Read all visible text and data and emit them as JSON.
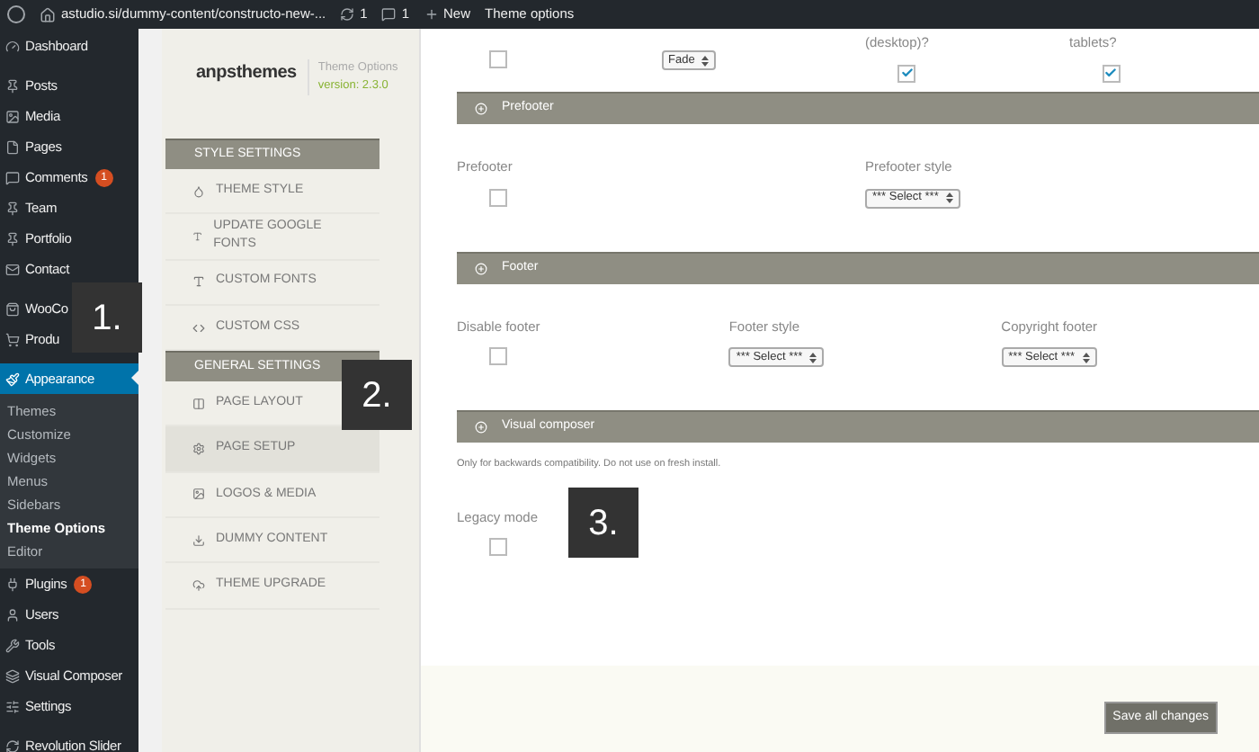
{
  "admin_bar": {
    "site_url": "astudio.si/dummy-content/constructo-new-...",
    "updates_count": "1",
    "comments_count": "1",
    "new_label": "New",
    "page_label": "Theme options"
  },
  "sidebar": {
    "groups": [
      [
        {
          "label": "Dashboard",
          "selected": false
        }
      ],
      [
        {
          "label": "Posts",
          "selected": false
        },
        {
          "label": "Media",
          "selected": false
        },
        {
          "label": "Pages",
          "selected": false
        },
        {
          "label": "Comments",
          "selected": false,
          "badge": "1"
        },
        {
          "label": "Team",
          "selected": false
        },
        {
          "label": "Portfolio",
          "selected": false
        },
        {
          "label": "Contact",
          "selected": false
        }
      ],
      [
        {
          "label": "WooCo",
          "selected": false
        },
        {
          "label": "Produ",
          "selected": false
        }
      ],
      [
        {
          "label": "Appearance",
          "selected": true,
          "children": [
            {
              "label": "Themes",
              "selected": false
            },
            {
              "label": "Customize",
              "selected": false
            },
            {
              "label": "Widgets",
              "selected": false
            },
            {
              "label": "Menus",
              "selected": false
            },
            {
              "label": "Sidebars",
              "selected": false
            },
            {
              "label": "Theme Options",
              "selected": true
            },
            {
              "label": "Editor",
              "selected": false
            }
          ]
        },
        {
          "label": "Plugins",
          "selected": false,
          "badge": "1"
        },
        {
          "label": "Users",
          "selected": false
        },
        {
          "label": "Tools",
          "selected": false
        },
        {
          "label": "Visual Composer",
          "selected": false
        },
        {
          "label": "Settings",
          "selected": false
        }
      ],
      [
        {
          "label": "Revolution Slider",
          "selected": false
        }
      ]
    ]
  },
  "theme_panel": {
    "brand": "anpsthemes",
    "title": "Theme Options",
    "version": "version: 2.3.0",
    "groups": [
      {
        "heading": "STYLE SETTINGS",
        "items": [
          {
            "label": "THEME STYLE",
            "selected": false
          },
          {
            "label": "UPDATE GOOGLE FONTS",
            "selected": false
          },
          {
            "label": "CUSTOM FONTS",
            "selected": false
          },
          {
            "label": "CUSTOM CSS",
            "selected": false
          }
        ]
      },
      {
        "heading": "GENERAL SETTINGS",
        "items": [
          {
            "label": "PAGE LAYOUT",
            "selected": false
          },
          {
            "label": "PAGE SETUP",
            "selected": true
          },
          {
            "label": "LOGOS & MEDIA",
            "selected": false
          },
          {
            "label": "DUMMY CONTENT",
            "selected": false
          },
          {
            "label": "THEME UPGRADE",
            "selected": false
          }
        ]
      }
    ]
  },
  "top_row": [
    {
      "kind": "checkbox",
      "checked": false
    },
    {
      "kind": "select",
      "value": "Fade"
    },
    {
      "kind": "checkbox",
      "label": "(desktop)?",
      "checked": true
    },
    {
      "kind": "checkbox",
      "label": "tablets?",
      "checked": true
    }
  ],
  "sections": [
    {
      "title": "Prefooter",
      "fields": [
        {
          "kind": "checkbox",
          "label": "Prefooter",
          "checked": false
        },
        {
          "kind": "select",
          "label": "Prefooter style",
          "value": "*** Select ***"
        }
      ]
    },
    {
      "title": "Footer",
      "fields": [
        {
          "kind": "checkbox",
          "label": "Disable footer",
          "checked": false
        },
        {
          "kind": "select",
          "label": "Footer style",
          "value": "*** Select ***"
        },
        {
          "kind": "select",
          "label": "Copyright footer",
          "value": "*** Select ***"
        }
      ]
    },
    {
      "title": "Visual composer",
      "note": "Only for backwards compatibility. Do not use on fresh install.",
      "fields": [
        {
          "kind": "checkbox",
          "label": "Legacy mode",
          "checked": false
        }
      ]
    }
  ],
  "save_button": "Save all changes",
  "annotations": [
    "1.",
    "2.",
    "3."
  ]
}
